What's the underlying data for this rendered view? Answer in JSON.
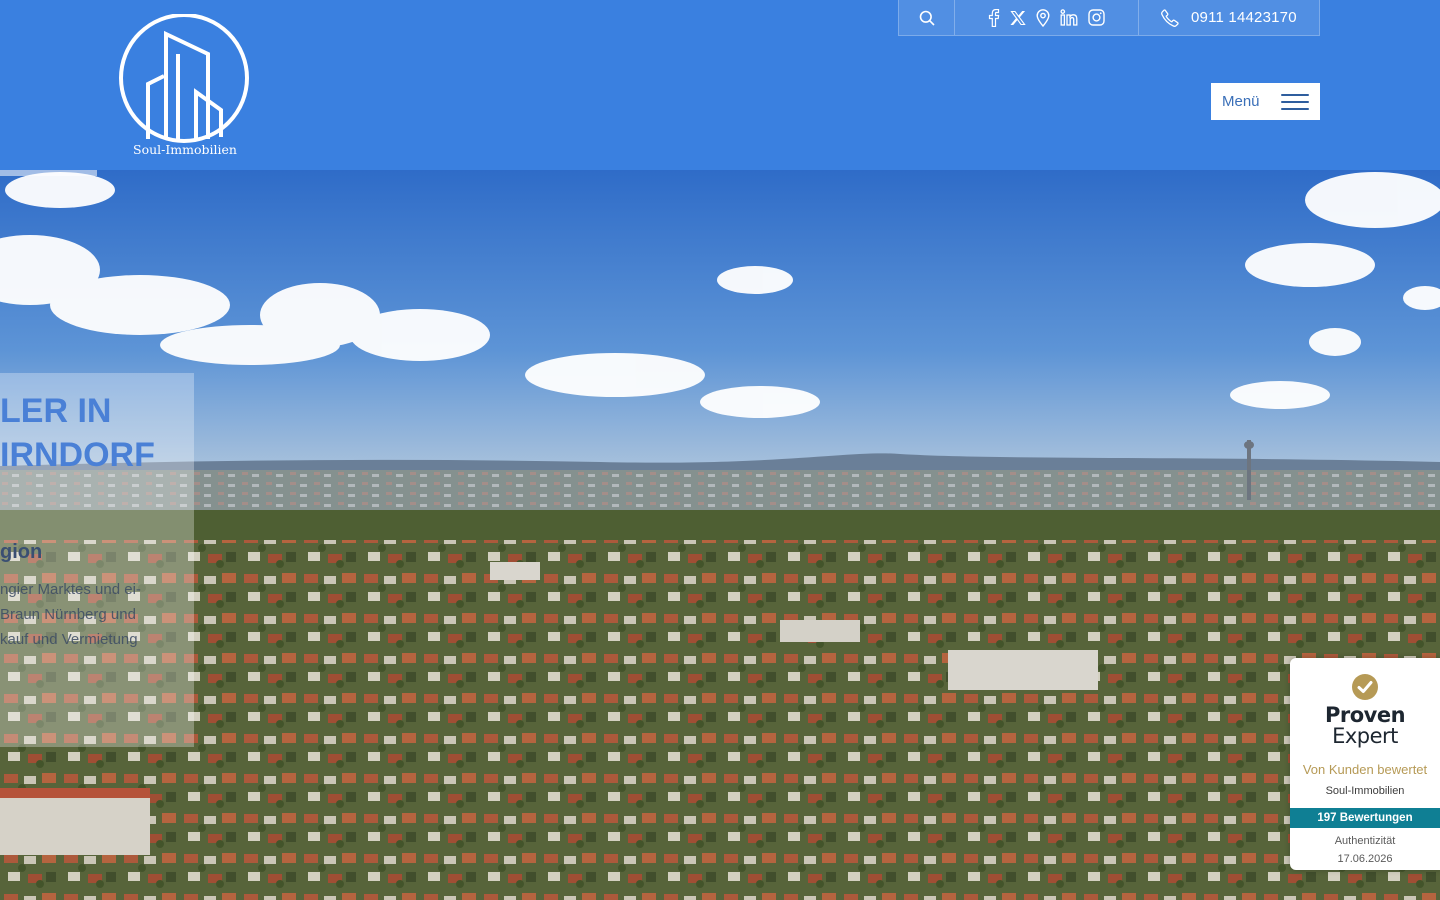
{
  "brand": {
    "name": "Soul-Immobilien"
  },
  "topbar": {
    "search_icon": "search-icon",
    "social": [
      "facebook-icon",
      "x-twitter-icon",
      "map-pin-icon",
      "linkedin-icon",
      "instagram-icon"
    ],
    "phone_icon": "phone-icon",
    "phone": "0911 14423170"
  },
  "menu": {
    "label": "Menü",
    "icon": "hamburger-icon"
  },
  "hero": {
    "headline": [
      "LER IN",
      "IRNDORF"
    ],
    "subheading": "gion",
    "text_lines": [
      "ngier Marktes und ei-",
      "Braun Nürnberg und",
      "kauf und Vermietung"
    ]
  },
  "proven_expert": {
    "brand_line1": "Proven",
    "brand_line2": "Expert",
    "rated": "Von Kunden bewertet",
    "company": "Soul-Immobilien",
    "reviews": "197 Bewertungen",
    "authenticity": "Authentizität",
    "date": "17.06.2026"
  },
  "colors": {
    "header": "#3a80e0",
    "accent_gold": "#b69a56",
    "review_bar": "#0f7f94"
  }
}
